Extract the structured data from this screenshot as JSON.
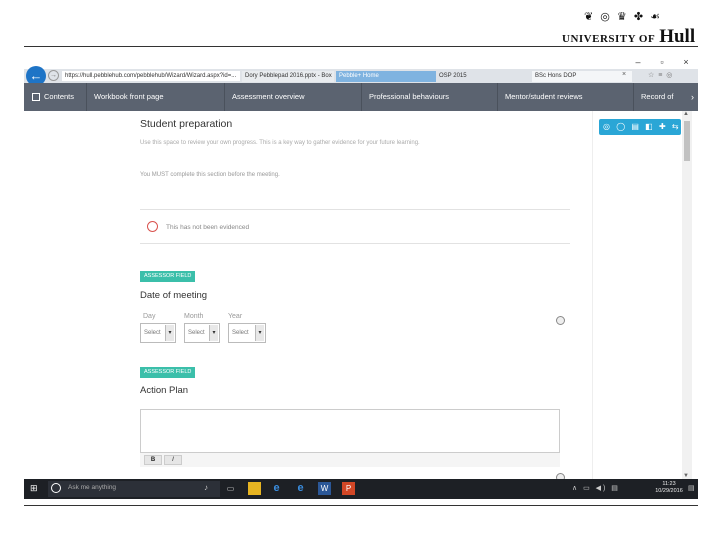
{
  "logo": {
    "crest": "❦ ◎ ♛ ✤ ☙",
    "university_small": "UNIVERSITY OF",
    "university_big": "Hull"
  },
  "window": {
    "minimize": "–",
    "restore": "▫",
    "close": "×"
  },
  "browser": {
    "address": "https://hull.pebblehub.com/pebblehub/Wizard/Wizard.aspx?id=...",
    "tabs": [
      {
        "label": "Dory Pebblepad 2016.pptx - Box"
      },
      {
        "label": "Pebble+ Home"
      },
      {
        "label": "OSP 2015"
      },
      {
        "label": "BSc Hons DOP"
      }
    ],
    "tab_close": "×"
  },
  "nav": {
    "contents": "Contents",
    "items": [
      {
        "label": "Workbook front page"
      },
      {
        "label": "Assessment overview"
      },
      {
        "label": "Professional behaviours"
      },
      {
        "label": "Mentor/student reviews"
      },
      {
        "label": "Record of"
      }
    ],
    "more_arrow": "›"
  },
  "main": {
    "title": "Student preparation",
    "description": "Use this space to review your own progress. This is a key way to gather evidence for your future learning.",
    "requirement": "You MUST complete this section before the meeting.",
    "evidence_status": "This has not been evidenced",
    "assessor_field_1": "ASSESSOR FIELD",
    "date_title": "Date of meeting",
    "date_labels": {
      "day": "Day",
      "month": "Month",
      "year": "Year"
    },
    "select_placeholder": "Select",
    "assessor_field_2": "ASSESSOR FIELD",
    "action_title": "Action Plan",
    "format_bold": "B",
    "format_italic": "I"
  },
  "toolstrip": "◎ ◯ ▤ ◧ ✚ ⇆",
  "taskbar": {
    "start": "⊞",
    "search_placeholder": "Ask me anything",
    "mic": "🎤",
    "task_view": "▭",
    "tray": "∧ ▭ ◀) ▤",
    "time": "11:23",
    "date": "10/29/2016",
    "notifications": "▤"
  },
  "colors": {
    "accent_blue": "#1e74c6",
    "nav_gray": "#5b6370",
    "teal_tag": "#3bbfaa",
    "toolstrip_blue": "#2aa6d6"
  }
}
